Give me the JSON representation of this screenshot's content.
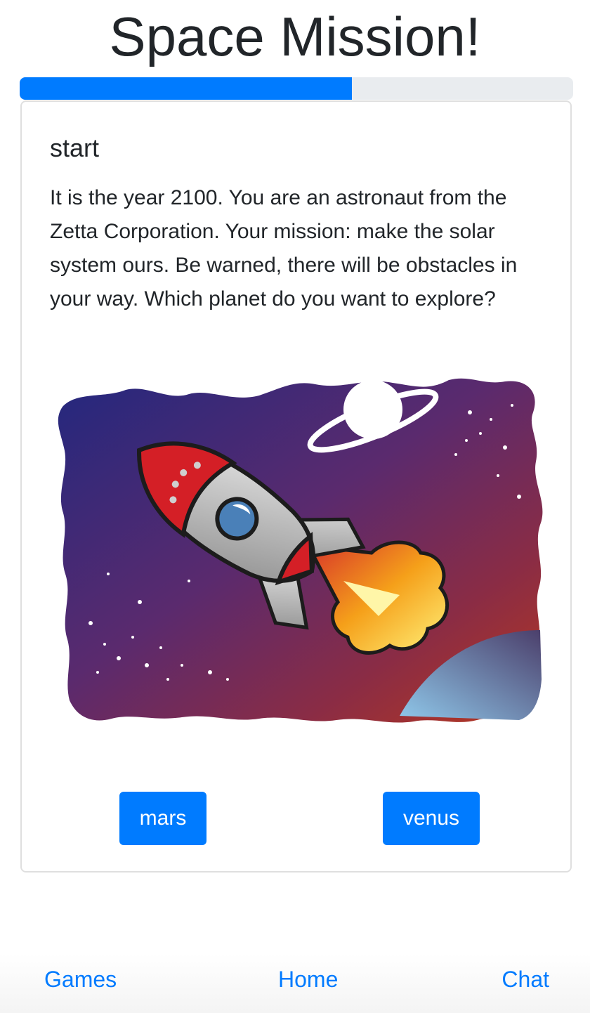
{
  "header": {
    "title": "Space Mission!"
  },
  "progress": {
    "percent": 60
  },
  "card": {
    "title": "start",
    "text": "It is the year 2100. You are an astronaut from the Zetta Corporation. Your mission: make the solar system ours. Be warned, there will be obstacles in your way. Which planet do you want to explore?",
    "image_icon": "rocket-illustration",
    "choices": [
      {
        "label": "mars"
      },
      {
        "label": "venus"
      }
    ]
  },
  "bottom_nav": {
    "items": [
      {
        "label": "Games"
      },
      {
        "label": "Home"
      },
      {
        "label": "Chat"
      }
    ]
  },
  "colors": {
    "primary": "#007bff",
    "track": "#e9ecef"
  }
}
